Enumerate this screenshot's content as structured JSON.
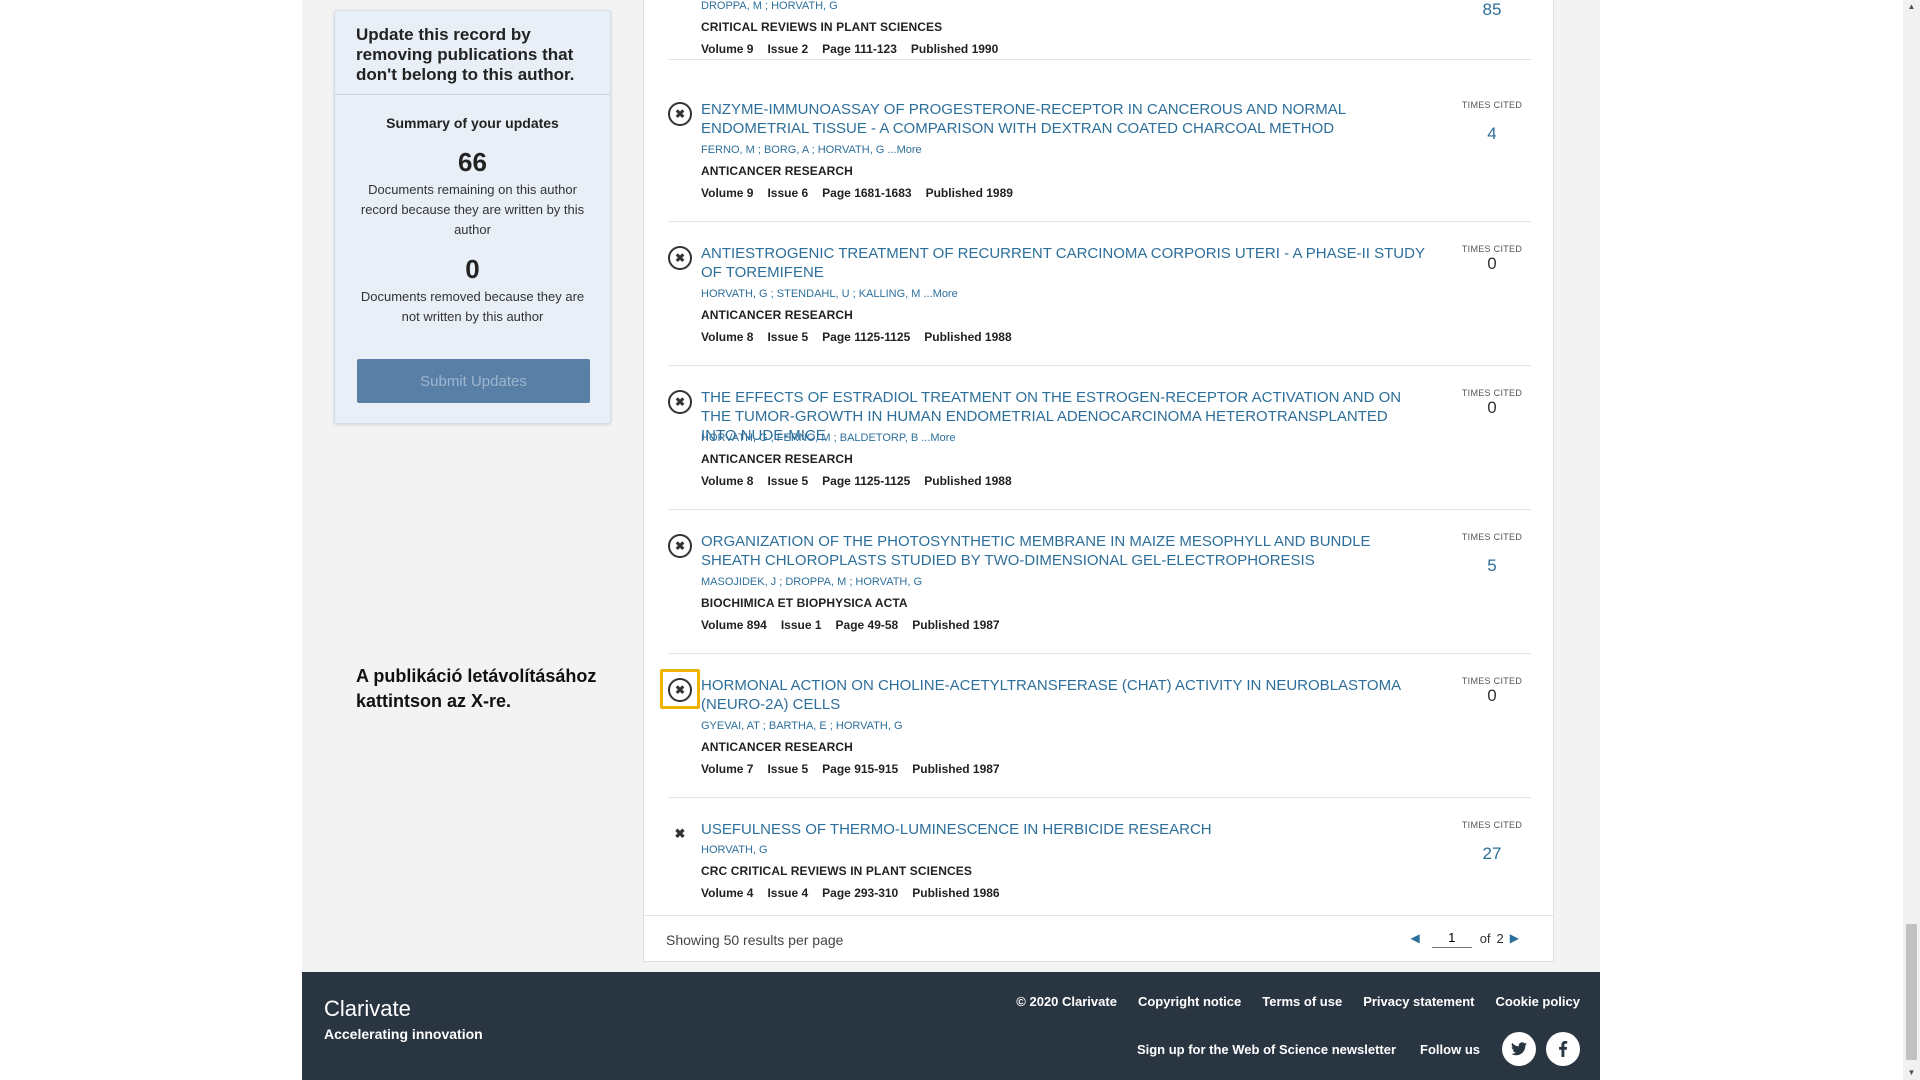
{
  "sidebar": {
    "heading": "Update this record by removing publications that don't belong to this author.",
    "summary_title": "Summary of your updates",
    "remaining_count": "66",
    "remaining_desc": "Documents remaining on this author record because they are written by this author",
    "removed_count": "0",
    "removed_desc": "Documents removed because they are not written by this author",
    "submit_label": "Submit Updates"
  },
  "hint": "A publikáció letávolításához kattintson az X-re.",
  "times_cited_label": "TIMES CITED",
  "publications": [
    {
      "title": "",
      "authors": "DROPPA, M ; HORVATH, G",
      "journal": "CRITICAL REVIEWS IN PLANT SCIENCES",
      "volume": "Volume 9",
      "issue": "Issue 2",
      "page": "Page 111-123",
      "published": "Published 1990",
      "times_cited": "85"
    },
    {
      "title": "ENZYME-IMMUNOASSAY OF PROGESTERONE-RECEPTOR IN CANCEROUS AND NORMAL ENDOMETRIAL TISSUE - A COMPARISON WITH DEXTRAN COATED CHARCOAL METHOD",
      "authors": "FERNO, M ; BORG, A ; HORVATH, G ...More",
      "journal": "ANTICANCER RESEARCH",
      "volume": "Volume 9",
      "issue": "Issue 6",
      "page": "Page 1681-1683",
      "published": "Published 1989",
      "times_cited": "4"
    },
    {
      "title": "ANTIESTROGENIC TREATMENT OF RECURRENT CARCINOMA CORPORIS UTERI - A PHASE-II STUDY OF TOREMIFENE",
      "authors": "HORVATH, G ; STENDAHL, U ; KALLING, M ...More",
      "journal": "ANTICANCER RESEARCH",
      "volume": "Volume 8",
      "issue": "Issue 5",
      "page": "Page 1125-1125",
      "published": "Published 1988",
      "times_cited": "0"
    },
    {
      "title": "THE EFFECTS OF ESTRADIOL TREATMENT ON THE ESTROGEN-RECEPTOR ACTIVATION AND ON THE TUMOR-GROWTH IN HUMAN ENDOMETRIAL ADENOCARCINOMA HETEROTRANSPLANTED INTO NUDE-MICE",
      "authors": "HORVATH, G ; FERNO, M ; BALDETORP, B ...More",
      "journal": "ANTICANCER RESEARCH",
      "volume": "Volume 8",
      "issue": "Issue 5",
      "page": "Page 1125-1125",
      "published": "Published 1988",
      "times_cited": "0"
    },
    {
      "title": "ORGANIZATION OF THE PHOTOSYNTHETIC MEMBRANE IN MAIZE MESOPHYLL AND BUNDLE SHEATH CHLOROPLASTS STUDIED BY TWO-DIMENSIONAL GEL-ELECTROPHORESIS",
      "authors": "MASOJIDEK, J ; DROPPA, M ; HORVATH, G",
      "journal": "BIOCHIMICA ET BIOPHYSICA ACTA",
      "volume": "Volume 894",
      "issue": "Issue 1",
      "page": "Page 49-58",
      "published": "Published 1987",
      "times_cited": "5"
    },
    {
      "title": "HORMONAL ACTION ON CHOLINE-ACETYLTRANSFERASE (CHAT) ACTIVITY IN NEUROBLASTOMA (NEURO-2A) CELLS",
      "authors": "GYEVAI, AT ; BARTHA, E ; HORVATH, G",
      "journal": "ANTICANCER RESEARCH",
      "volume": "Volume 7",
      "issue": "Issue 5",
      "page": "Page 915-915",
      "published": "Published 1987",
      "times_cited": "0"
    },
    {
      "title": "USEFULNESS OF THERMO-LUMINESCENCE IN HERBICIDE RESEARCH",
      "authors": "HORVATH, G",
      "journal": "CRC CRITICAL REVIEWS IN PLANT SCIENCES",
      "volume": "Volume 4",
      "issue": "Issue 4",
      "page": "Page 293-310",
      "published": "Published 1986",
      "times_cited": "27"
    }
  ],
  "results_footer": {
    "per_page": "Showing 50 results per page",
    "page_value": "1",
    "of_label": "of",
    "total_pages": "2"
  },
  "footer": {
    "brand": "Clarivate",
    "tagline": "Accelerating innovation",
    "copyright": "© 2020 Clarivate",
    "copyright_notice": "Copyright notice",
    "terms": "Terms of use",
    "privacy": "Privacy statement",
    "cookie": "Cookie policy",
    "newsletter": "Sign up for the Web of Science newsletter",
    "follow": "Follow us"
  },
  "icons": {
    "remove": "remove-x-icon",
    "twitter": "twitter-icon",
    "facebook": "facebook-icon"
  },
  "colors": {
    "link": "#2d6f9b",
    "focus_outline": "#f0b400",
    "footer_bg": "#2a3542",
    "submit_bg": "#5a7fa6"
  }
}
